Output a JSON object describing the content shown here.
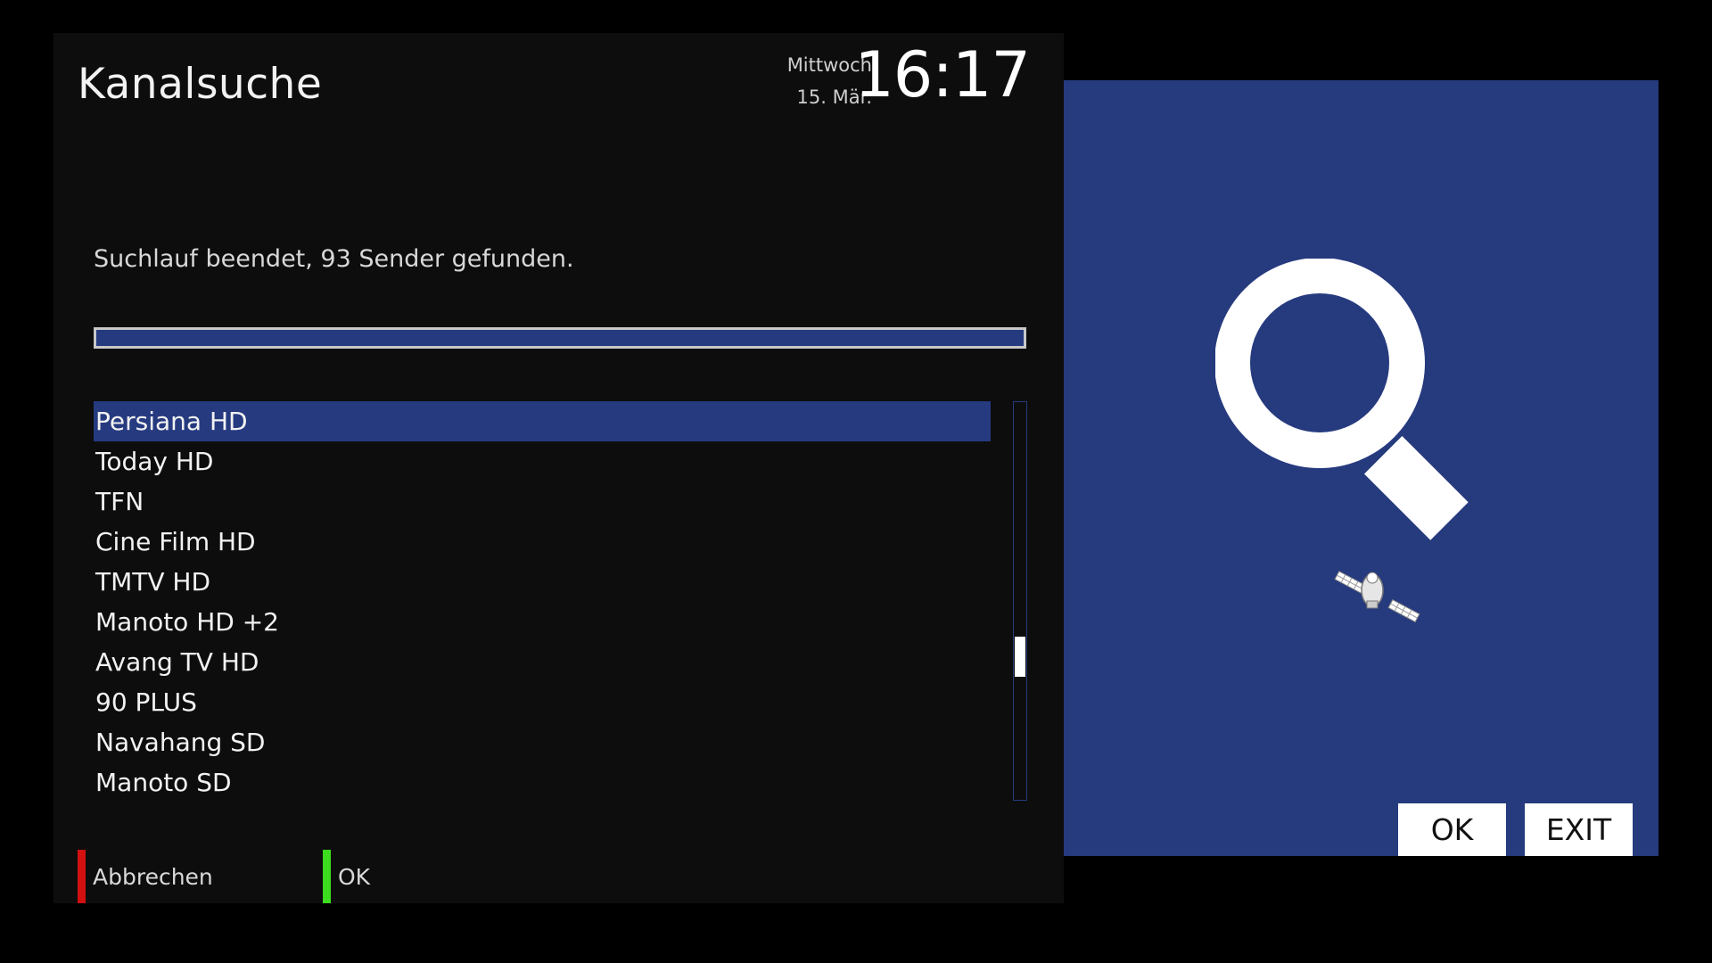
{
  "header": {
    "title": "Kanalsuche",
    "weekday": "Mittwoch",
    "date": "15. Mär.",
    "time": "16:17"
  },
  "scan": {
    "status": "Suchlauf beendet, 93 Sender gefunden.",
    "progress_fraction": 1.0
  },
  "channels": [
    {
      "label": "Persiana HD",
      "selected": true
    },
    {
      "label": "Today HD"
    },
    {
      "label": "TFN"
    },
    {
      "label": "Cine Film HD"
    },
    {
      "label": "TMTV HD"
    },
    {
      "label": "Manoto HD +2"
    },
    {
      "label": "Avang TV HD"
    },
    {
      "label": "90 PLUS"
    },
    {
      "label": "Navahang SD"
    },
    {
      "label": "Manoto SD"
    }
  ],
  "scrollbar": {
    "thumb_start_fraction": 0.59,
    "thumb_size_fraction": 0.1
  },
  "footer": {
    "red_label": "Abbrechen",
    "green_label": "OK"
  },
  "side_panel": {
    "ok_label": "OK",
    "exit_label": "EXIT"
  },
  "colors": {
    "accent_blue": "#263a80",
    "red_key": "#d21010",
    "green_key": "#3cdc1e"
  },
  "icons": {
    "magnifier": "search-icon",
    "satellite": "satellite-icon"
  }
}
